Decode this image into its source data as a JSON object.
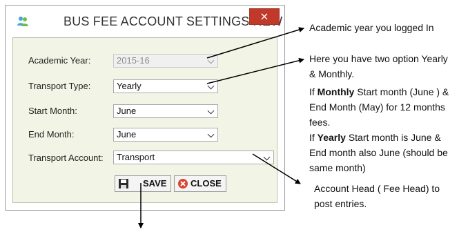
{
  "window": {
    "title": "BUS FEE ACCOUNT SETTINGS NEW",
    "close_glyph": "×"
  },
  "form": {
    "academic_year": {
      "label": "Academic Year:",
      "value": "2015-16",
      "disabled": true
    },
    "transport_type": {
      "label": "Transport Type:",
      "value": "Yearly"
    },
    "start_month": {
      "label": "Start Month:",
      "value": "June"
    },
    "end_month": {
      "label": "End Month:",
      "value": "June"
    },
    "transport_account": {
      "label": "Transport Account:",
      "value": "Transport"
    }
  },
  "buttons": {
    "save": {
      "label": "SAVE",
      "icon": "floppy-disk-icon"
    },
    "close": {
      "label": "CLOSE",
      "icon": "close-circle-icon"
    }
  },
  "annotations": {
    "academic_year": "Academic year you logged In",
    "transport_type": [
      "Here you have two option Yearly",
      "& Monthly."
    ],
    "months": {
      "monthly_prefix": "If ",
      "monthly_bold": "Monthly",
      "monthly_line1_rest": " Start month (June ) &",
      "monthly_line2": "End Month (May) for 12 months",
      "monthly_line3": "fees.",
      "yearly_prefix": "If ",
      "yearly_bold": "Yearly",
      "yearly_line1_rest": "  Start month is June &",
      "yearly_line2": "End month also June (should be",
      "yearly_line3": "same month)"
    },
    "account": [
      "Account Head ( Fee Head)  to",
      "post entries."
    ]
  },
  "colors": {
    "close_button": "#c0392b",
    "client_background": "#f2f5e6",
    "disabled_text": "#8c8c8c"
  }
}
